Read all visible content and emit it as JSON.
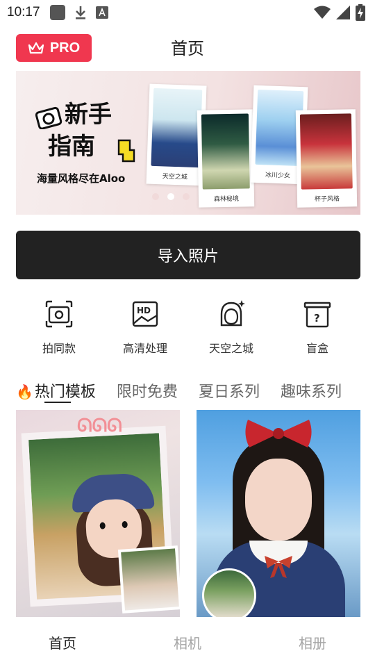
{
  "status_bar": {
    "time": "10:17",
    "icons": [
      "notification-square-icon",
      "download-icon",
      "text-app-icon",
      "wifi-icon",
      "signal-icon",
      "battery-charging-icon"
    ]
  },
  "header": {
    "pro_label": "PRO",
    "title": "首页"
  },
  "banner": {
    "title_line1": "新手",
    "title_line2": "指南",
    "subtitle": "海量风格尽在Aloo",
    "cards": [
      {
        "caption": "天空之城"
      },
      {
        "caption": "森林秘境"
      },
      {
        "caption": "冰川少女"
      },
      {
        "caption": "杯子风格"
      }
    ],
    "dots_total": 3,
    "active_dot": 2
  },
  "import_button": {
    "label": "导入照片"
  },
  "features": [
    {
      "label": "拍同款",
      "icon": "camera-frame-icon"
    },
    {
      "label": "高清处理",
      "icon": "hd-image-icon"
    },
    {
      "label": "天空之城",
      "icon": "girl-portrait-icon"
    },
    {
      "label": "盲盒",
      "icon": "mystery-box-icon"
    }
  ],
  "tabs": [
    {
      "label": "热门模板",
      "active": true,
      "icon": "fire-icon"
    },
    {
      "label": "限时免费",
      "active": false
    },
    {
      "label": "夏日系列",
      "active": false
    },
    {
      "label": "趣味系列",
      "active": false
    }
  ],
  "templates": [
    {
      "name": "cartoon-doll-template"
    },
    {
      "name": "sky-girl-template"
    }
  ],
  "bottom_nav": [
    {
      "label": "首页",
      "active": true
    },
    {
      "label": "相机",
      "active": false
    },
    {
      "label": "相册",
      "active": false
    }
  ],
  "colors": {
    "pro_badge": "#f0374f",
    "import_button": "#222222",
    "nav_active": "#222222",
    "nav_inactive": "#a5a5a5"
  }
}
